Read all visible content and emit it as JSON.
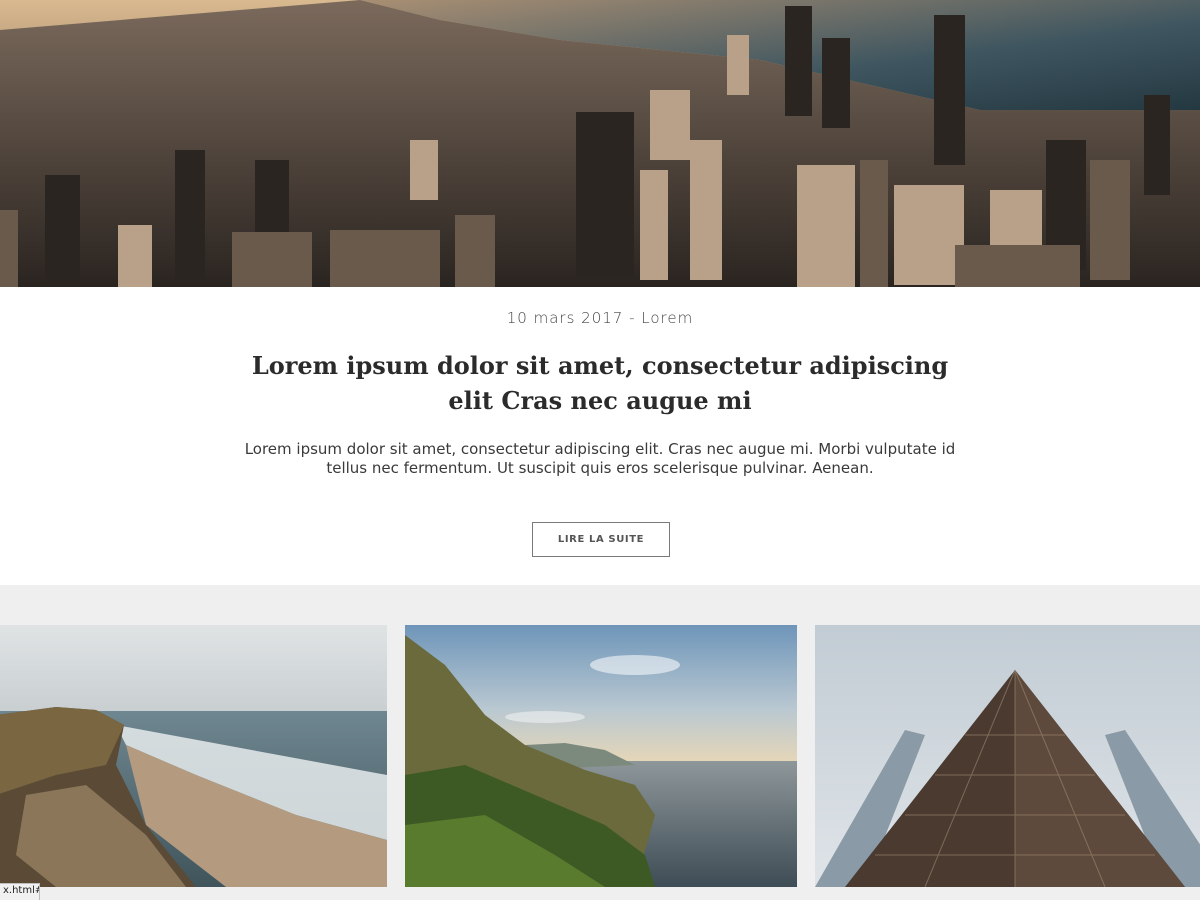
{
  "hero": {
    "image": "city-skyline-aerial-sunset"
  },
  "post": {
    "meta": "10 mars 2017 - Lorem",
    "title": "Lorem ipsum dolor sit amet, consectetur adipiscing elit Cras nec augue mi",
    "excerpt": "Lorem ipsum dolor sit amet, consectetur adipiscing elit. Cras nec augue mi. Morbi vulputate id tellus nec fermentum. Ut suscipit quis eros scelerisque pulvinar. Aenean.",
    "read_more_label": "LIRE LA SUITE"
  },
  "cards": [
    {
      "image": "beach-cliff-shoreline"
    },
    {
      "image": "coastal-mountain-sea"
    },
    {
      "image": "glass-skyscraper-low-angle"
    }
  ],
  "status_bar": {
    "url": "x.html#"
  },
  "colors": {
    "text_dark": "#2b2b2b",
    "text_body": "#3a3a3a",
    "grid_background": "#efefef",
    "button_border": "#7a7a7a"
  }
}
